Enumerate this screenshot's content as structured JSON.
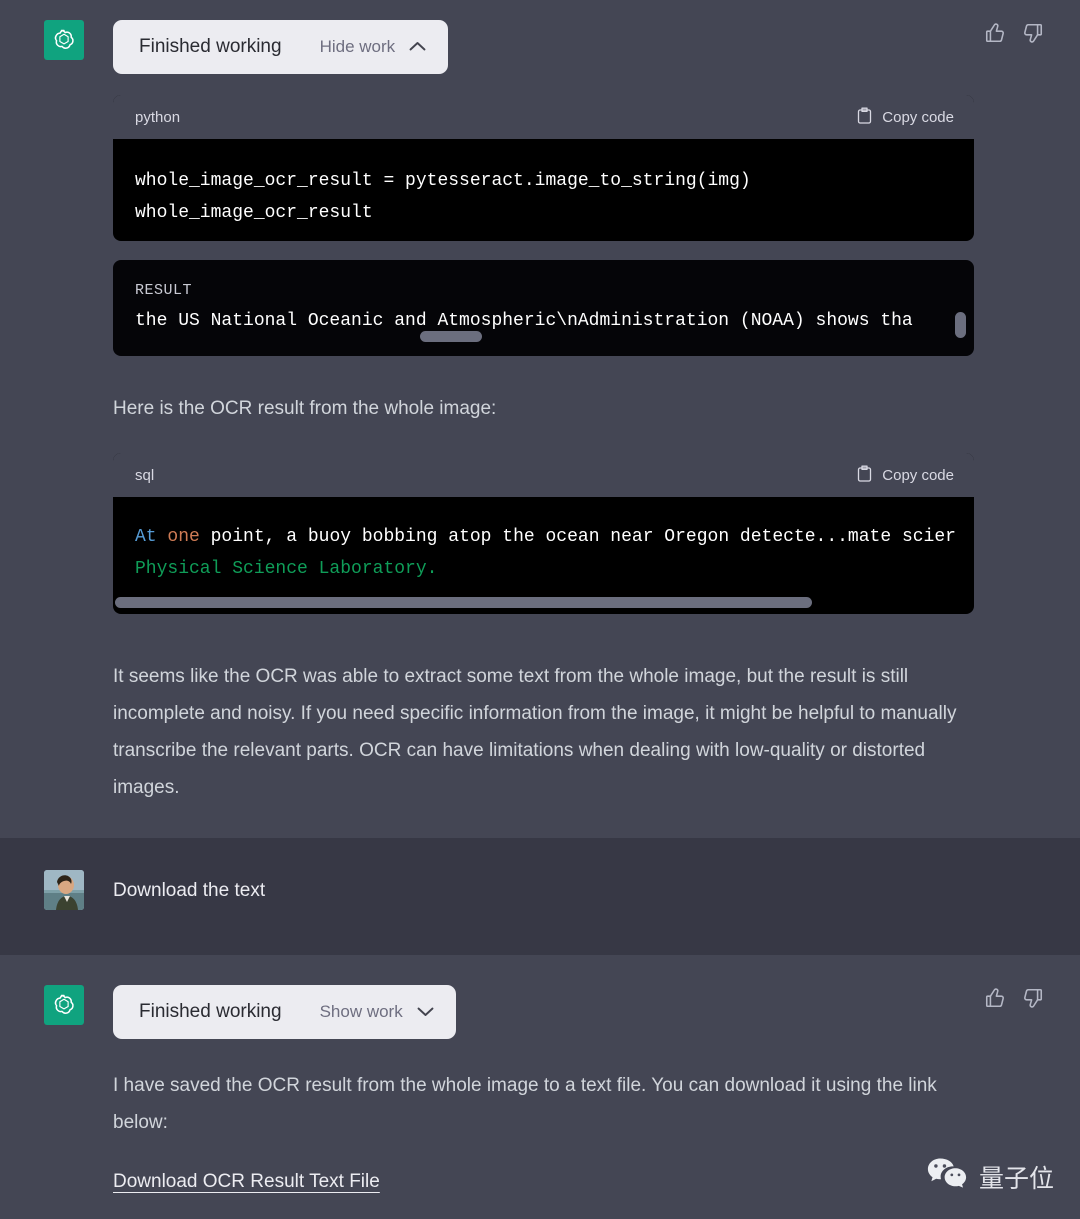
{
  "theme": {
    "assistant_bg": "#444654",
    "user_bg": "#373845",
    "pill_bg": "#ececf1",
    "brand_green": "#10a37f",
    "code_bg": "#000000",
    "token_blue": "#569cd6",
    "token_orange": "#ce7b55",
    "token_green": "#0f9d58"
  },
  "message1": {
    "avatar": "chatgpt-logo-icon",
    "work_pill": {
      "title": "Finished working",
      "toggle_label": "Hide work",
      "chevron": "chevron-up-icon"
    },
    "feedback": {
      "thumbs_up": "thumbs-up-icon",
      "thumbs_down": "thumbs-down-icon"
    },
    "code_python": {
      "language": "python",
      "copy_label": "Copy code",
      "copy_icon": "clipboard-icon",
      "line1": "whole_image_ocr_result = pytesseract.image_to_string(img)",
      "line2": "whole_image_ocr_result"
    },
    "result_panel": {
      "label": "RESULT",
      "text": "the US National Oceanic and Atmospheric\\nAdministration (NOAA) shows tha"
    },
    "paragraph_intro": "Here is the OCR result from the whole image:",
    "code_sql": {
      "language": "sql",
      "copy_label": "Copy code",
      "copy_icon": "clipboard-icon",
      "line1_tok1": "At",
      "line1_tok2": "one",
      "line1_rest": " point, a buoy bobbing atop the ocean near Oregon detecte...mate scier",
      "line2": "Physical Science Laboratory."
    },
    "paragraph_outro": "It seems like the OCR was able to extract some text from the whole image, but the result is still incomplete and noisy. If you need specific information from the image, it might be helpful to manually transcribe the relevant parts. OCR can have limitations when dealing with low-quality or distorted images."
  },
  "message2": {
    "avatar": "user-photo-avatar",
    "text": "Download the text"
  },
  "message3": {
    "avatar": "chatgpt-logo-icon",
    "work_pill": {
      "title": "Finished working",
      "toggle_label": "Show work",
      "chevron": "chevron-down-icon"
    },
    "feedback": {
      "thumbs_up": "thumbs-up-icon",
      "thumbs_down": "thumbs-down-icon"
    },
    "paragraph": "I have saved the OCR result from the whole image to a text file. You can download it using the link below:",
    "download_link": "Download OCR Result Text File"
  },
  "watermark": {
    "icon": "wechat-icon",
    "text": "量子位"
  }
}
